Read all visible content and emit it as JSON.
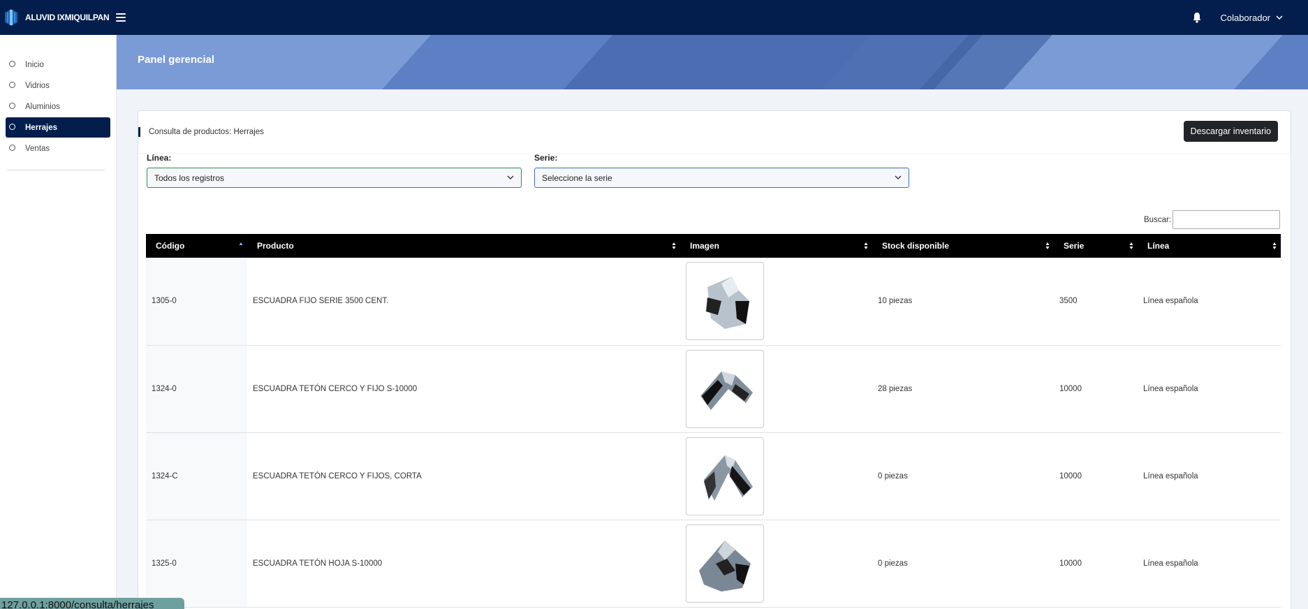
{
  "topbar": {
    "brand_name": "ALUVID IXMIQUILPAN",
    "user_label": "Colaborador"
  },
  "sidebar": {
    "items": [
      {
        "label": "Inicio"
      },
      {
        "label": "Vidrios"
      },
      {
        "label": "Aluminios"
      },
      {
        "label": "Herrajes",
        "active": true
      },
      {
        "label": "Ventas"
      }
    ]
  },
  "banner": {
    "title": "Panel gerencial"
  },
  "card": {
    "title": "Consulta de productos: Herrajes",
    "download_label": "Descargar inventario"
  },
  "filters": {
    "linea_label": "Línea:",
    "linea_value": "Todos los registros",
    "serie_label": "Serie:",
    "serie_value": "Seleccione la serie"
  },
  "search": {
    "label": "Buscar:"
  },
  "table": {
    "columns": [
      "Código",
      "Producto",
      "Imagen",
      "Stock disponible",
      "Serie",
      "Línea"
    ],
    "rows": [
      {
        "codigo": "1305-0",
        "producto": "ESCUADRA FIJO SERIE 3500 CENT.",
        "stock": "10 piezas",
        "serie": "3500",
        "linea": "Línea española"
      },
      {
        "codigo": "1324-0",
        "producto": "ESCUADRA TETÓN CERCO Y FIJO S-10000",
        "stock": "28 piezas",
        "serie": "10000",
        "linea": "Línea española"
      },
      {
        "codigo": "1324-C",
        "producto": "ESCUADRA TETÓN CERCO Y FIJOS, CORTA",
        "stock": "0 piezas",
        "serie": "10000",
        "linea": "Línea española"
      },
      {
        "codigo": "1325-0",
        "producto": "ESCUADRA TETÓN HOJA S-10000",
        "stock": "0 piezas",
        "serie": "10000",
        "linea": "Línea española"
      }
    ]
  },
  "status_bar": {
    "url": "127.0.0.1:8000/consulta/herrajes"
  },
  "colors": {
    "navy": "#031e4c",
    "banner": "#7a9bd6",
    "table_header": "#000000",
    "button_dark": "#212529"
  }
}
